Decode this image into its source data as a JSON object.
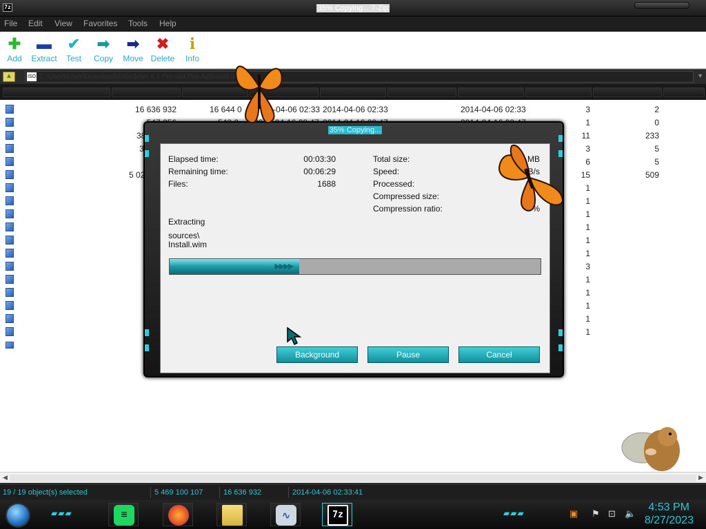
{
  "window": {
    "icon": "7z",
    "title": "35% Copying... 7-Zip"
  },
  "menu": [
    "File",
    "Edit",
    "View",
    "Favorites",
    "Tools",
    "Help"
  ],
  "toolbar": [
    {
      "label": "Add",
      "icon": "add-icon"
    },
    {
      "label": "Extract",
      "icon": "extract-icon"
    },
    {
      "label": "Test",
      "icon": "test-icon"
    },
    {
      "label": "Copy",
      "icon": "copy-icon"
    },
    {
      "label": "Move",
      "icon": "move-icon"
    },
    {
      "label": "Delete",
      "icon": "delete-icon"
    },
    {
      "label": "Info",
      "icon": "info-icon"
    }
  ],
  "address": {
    "iso_label": "ISO",
    "path": "C:\\Users\\User\\Downloads\\Windows 8.1 Pro x64 Pre-Activated.iso\\"
  },
  "files": [
    {
      "size": "16 636 932",
      "packed": "16 644 0",
      "modified": "-04-06 02:33",
      "created": "2014-04-06 02:33",
      "accessed": "2014-04-06 02:33",
      "folders": "3",
      "files": "2"
    },
    {
      "size": "547 256",
      "packed": "548 0",
      "modified": "2014-04-16 00:47",
      "created": "2014-04-16 00:47",
      "accessed": "2014-04-16 00:47",
      "folders": "1",
      "files": "0"
    },
    {
      "size": "38",
      "folders": "11",
      "files": "233"
    },
    {
      "size": "3",
      "folders": "3",
      "files": "5"
    },
    {
      "size": "",
      "folders": "6",
      "files": "5"
    },
    {
      "size": "5 02",
      "folders": "15",
      "files": "509"
    },
    {
      "folders": "1"
    },
    {
      "folders": "1"
    },
    {
      "folders": "1"
    },
    {
      "folders": "1"
    },
    {
      "folders": "1"
    },
    {
      "folders": "1"
    },
    {
      "folders": "3"
    },
    {
      "folders": "1"
    },
    {
      "folders": "1"
    },
    {
      "folders": "1"
    },
    {
      "folders": "1"
    },
    {
      "folders": "1"
    }
  ],
  "status": {
    "selected": "19 / 19 object(s) selected",
    "total_size": "5 469 100 107",
    "item_size": "16 636 932",
    "date": "2014-04-06 02:33:41"
  },
  "dialog": {
    "title": "35% Copying...",
    "elapsed_label": "Elapsed time:",
    "elapsed_value": "00:03:30",
    "remaining_label": "Remaining time:",
    "remaining_value": "00:06:29",
    "files_label": "Files:",
    "files_value": "1688",
    "total_label": "Total size:",
    "total_value": "MB",
    "speed_label": "Speed:",
    "speed_value": "KB/s",
    "processed_label": "Processed:",
    "processed_value": "MB",
    "compressed_label": "Compressed size:",
    "ratio_label": "Compression ratio:",
    "ratio_value": "%",
    "operation": "Extracting",
    "path_line1": "sources\\",
    "path_line2": "Install.wim",
    "progress": 0.35,
    "buttons": {
      "background": "Background",
      "pause": "Pause",
      "cancel": "Cancel"
    }
  },
  "taskbar": {
    "time": "4:53 PM",
    "date": "8/27/2023",
    "tasks": [
      "spotify-icon",
      "firefox-icon",
      "file-explorer-icon",
      "resource-monitor-icon",
      "7zip-icon"
    ],
    "active_task": "7z"
  },
  "colors": {
    "accent": "#2bd0e0",
    "toolbar_label": "#2ca7c5",
    "progress": "#1d9aa8"
  }
}
